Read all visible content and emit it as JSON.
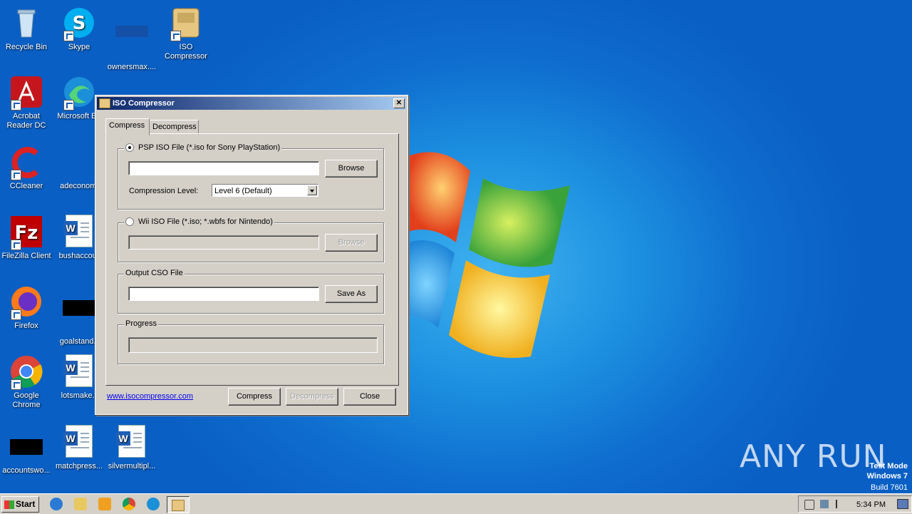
{
  "desktop": {
    "icons": [
      {
        "label": "Recycle Bin"
      },
      {
        "label": "Skype"
      },
      {
        "label": "ownersmax...."
      },
      {
        "label": "ISO Compressor"
      },
      {
        "label": "Acrobat Reader DC"
      },
      {
        "label": "Microsoft Ed"
      },
      {
        "label": "CCleaner"
      },
      {
        "label": "adeconomi"
      },
      {
        "label": "FileZilla Client"
      },
      {
        "label": "bushaccour"
      },
      {
        "label": "Firefox"
      },
      {
        "label": "goalstand.r"
      },
      {
        "label": "Google Chrome"
      },
      {
        "label": "lotsmake.r"
      },
      {
        "label": "accountswo..."
      },
      {
        "label": "matchpress..."
      },
      {
        "label": "silvermultipl..."
      }
    ],
    "watermark": {
      "line1": "Test Mode",
      "line2": "Windows 7",
      "line3": "Build 7601"
    },
    "anyrun_text": "ANY RUN"
  },
  "window": {
    "title": "ISO Compressor",
    "close_glyph": "✕",
    "tabs": [
      {
        "label": "Compress",
        "active": true
      },
      {
        "label": "Decompress",
        "active": false
      }
    ],
    "psp": {
      "radio_label": "PSP ISO File (*.iso for Sony PlayStation)",
      "selected": true,
      "input_value": "",
      "browse_label": "Browse",
      "compression_label": "Compression Level:",
      "compression_value": "Level 6 (Default)"
    },
    "wii": {
      "radio_label": "Wii ISO File (*.iso; *.wbfs for Nintendo)",
      "selected": false,
      "input_value": "",
      "browse_label": "Browse"
    },
    "output": {
      "caption": "Output CSO File",
      "input_value": "",
      "saveas_label": "Save As"
    },
    "progress": {
      "caption": "Progress",
      "value": 0
    },
    "footer": {
      "link": "www.isocompressor.com",
      "compress_label": "Compress",
      "decompress_label": "Decompress",
      "close_label": "Close"
    }
  },
  "taskbar": {
    "start_label": "Start",
    "clock": "5:34 PM"
  }
}
